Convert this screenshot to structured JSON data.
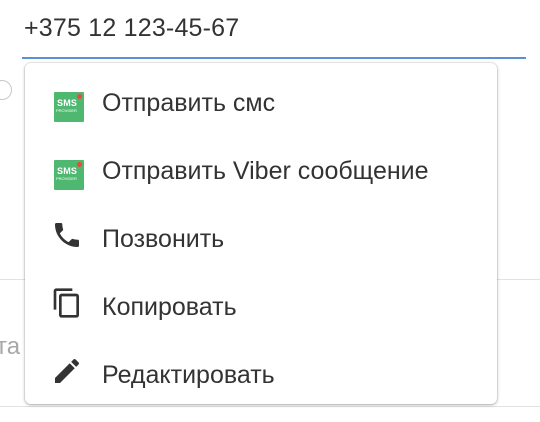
{
  "phone_field": {
    "value": "+375 12 123-45-67"
  },
  "background": {
    "partial_text": "та"
  },
  "menu": {
    "items": [
      {
        "label": "Отправить смс",
        "icon": "sms-provider-icon",
        "logo_text": "SMS",
        "logo_sub": "PROVIDER"
      },
      {
        "label": "Отправить Viber сообщение",
        "icon": "sms-provider-icon",
        "logo_text": "SMS",
        "logo_sub": "PROVIDER"
      },
      {
        "label": "Позвонить",
        "icon": "phone-icon"
      },
      {
        "label": "Копировать",
        "icon": "copy-icon"
      },
      {
        "label": "Редактировать",
        "icon": "pencil-icon"
      }
    ]
  },
  "colors": {
    "accent_underline": "#5b8fd6",
    "sms_logo": "#4fb870",
    "text": "#333333"
  }
}
